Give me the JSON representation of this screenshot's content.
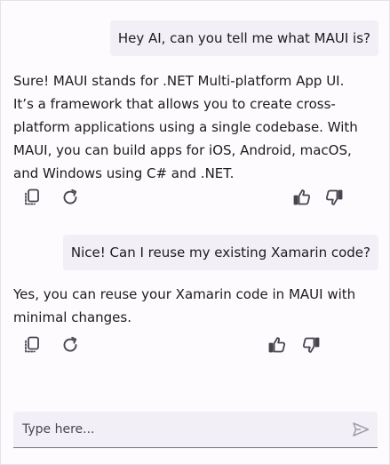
{
  "conversation": [
    {
      "role": "user",
      "text": "Hey AI, can you tell me what MAUI is?"
    },
    {
      "role": "assistant",
      "text": "Sure! MAUI stands for .NET Multi-platform App UI. It’s a framework that allows you to create cross-platform applications using a single codebase. With MAUI, you can build apps for iOS, Android, macOS, and Windows using C# and .NET.",
      "actions": [
        "copy-icon",
        "regenerate-icon",
        "like-icon",
        "dislike-icon"
      ]
    },
    {
      "role": "user",
      "text": "Nice! Can I reuse my existing Xamarin code?"
    },
    {
      "role": "assistant",
      "text": " Yes, you can reuse your Xamarin code in MAUI with minimal changes.",
      "actions": [
        "copy-icon",
        "regenerate-icon",
        "like-icon",
        "dislike-icon"
      ]
    }
  ],
  "composer": {
    "placeholder": "Type here...",
    "value": "",
    "send_icon": "send-icon"
  },
  "colors": {
    "background": "#fdfbfe",
    "user_bubble": "#f3eff7",
    "icon": "#49454f",
    "send_icon": "#a39fa8",
    "input_underline": "#79747e"
  }
}
